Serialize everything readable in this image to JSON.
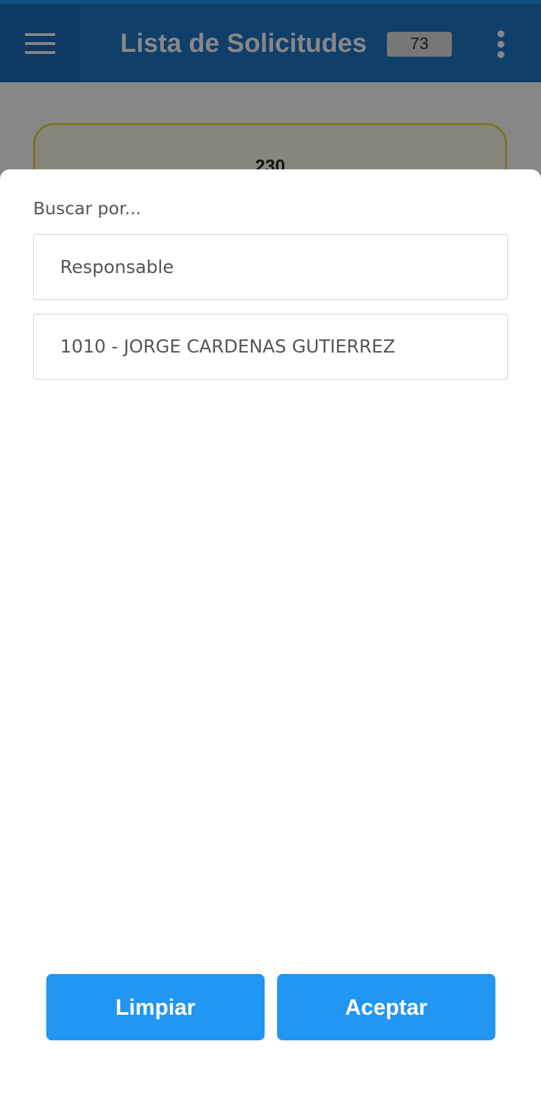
{
  "app_bar": {
    "title": "Lista de Solicitudes",
    "count": "73",
    "menu_icon": "hamburger-menu-icon",
    "more_icon": "more-vertical-icon",
    "color": "#1f78c8"
  },
  "background": {
    "card_number": "230",
    "card_border_color": "#e6d84a"
  },
  "filter_sheet": {
    "label": "Buscar por...",
    "search_type": "Responsable",
    "search_value": "1010 - JORGE CARDENAS GUTIERREZ",
    "clear_label": "Limpiar",
    "accept_label": "Aceptar",
    "button_color": "#2196f3"
  }
}
